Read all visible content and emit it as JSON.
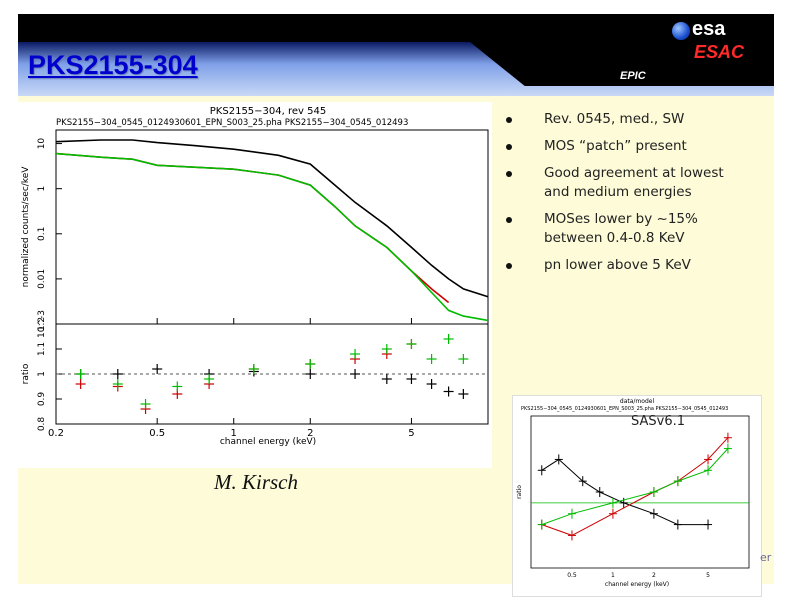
{
  "header": {
    "title": "PKS2155-304",
    "logo_text": "esa",
    "org": "ESAC",
    "section": "EPIC"
  },
  "bullets": [
    "Rev. 0545, med., SW",
    "MOS “patch” present",
    "Good agreement at lowest and medium energies",
    "MOSes lower by ~15% between 0.4-0.8 KeV",
    "pn lower above 5 KeV"
  ],
  "author": "M. Kirsch",
  "inset_label": "SASv6.1",
  "footer_cut_text": "er",
  "chart_data": [
    {
      "type": "line",
      "title": "PKS2155−304, rev 545",
      "subtitle": "PKS2155−304_0545_0124930601_EPN_S003_25.pha PKS2155−304_0545_012493",
      "xlabel": "channel energy (keV)",
      "ylabel": "normalized counts/sec/keV",
      "x_scale": "log",
      "y_scale": "log",
      "xlim": [
        0.2,
        10
      ],
      "ylim": [
        0.001,
        20
      ],
      "x_ticks": [
        "0.2",
        "0.5",
        "1",
        "2",
        "5"
      ],
      "y_ticks": [
        "10",
        "1",
        "0.1",
        "0.01",
        "10^-3"
      ],
      "series": [
        {
          "color": "#000000",
          "x": [
            0.2,
            0.3,
            0.4,
            0.5,
            0.7,
            1.0,
            1.5,
            2.0,
            2.5,
            3.0,
            4.0,
            5.0,
            6.0,
            7.0,
            8.0,
            10.0
          ],
          "y": [
            11,
            12,
            12,
            10.5,
            9,
            7.5,
            5.5,
            3.5,
            1.2,
            0.5,
            0.15,
            0.05,
            0.02,
            0.01,
            0.006,
            0.004
          ]
        },
        {
          "color": "#cc0000",
          "x": [
            0.2,
            0.3,
            0.4,
            0.5,
            0.7,
            1.0,
            1.5,
            2.0,
            2.5,
            3.0,
            4.0,
            5.0,
            6.0,
            7.0
          ],
          "y": [
            6,
            5,
            4.5,
            3.3,
            3.0,
            2.7,
            2.0,
            1.2,
            0.4,
            0.15,
            0.05,
            0.015,
            0.006,
            0.003
          ]
        },
        {
          "color": "#00bb00",
          "x": [
            0.2,
            0.3,
            0.4,
            0.5,
            0.7,
            1.0,
            1.5,
            2.0,
            2.5,
            3.0,
            4.0,
            5.0,
            6.0,
            7.0,
            8.0,
            10.0
          ],
          "y": [
            6,
            5,
            4.5,
            3.3,
            3.0,
            2.7,
            2.0,
            1.2,
            0.4,
            0.15,
            0.05,
            0.015,
            0.005,
            0.002,
            0.0015,
            0.0012
          ]
        }
      ]
    },
    {
      "type": "scatter",
      "ylabel": "ratio",
      "xlabel": "channel energy (keV)",
      "x_scale": "log",
      "xlim": [
        0.2,
        10
      ],
      "ylim": [
        0.8,
        1.2
      ],
      "y_ticks": [
        "0.8",
        "0.9",
        "1",
        "1.1",
        "1.2"
      ],
      "x_ticks": [
        "0.2",
        "0.5",
        "1",
        "2",
        "5"
      ],
      "series": [
        {
          "color": "#000000",
          "x": [
            0.25,
            0.35,
            0.5,
            0.8,
            1.2,
            2.0,
            3.0,
            4.0,
            5.0,
            6.0,
            7.0,
            8.0
          ],
          "y": [
            1.0,
            1.0,
            1.02,
            1.0,
            1.01,
            1.0,
            1.0,
            0.98,
            0.98,
            0.96,
            0.93,
            0.92
          ]
        },
        {
          "color": "#cc0000",
          "x": [
            0.25,
            0.35,
            0.45,
            0.6,
            0.8,
            1.2,
            2.0,
            3.0,
            4.0,
            5.0
          ],
          "y": [
            0.96,
            0.95,
            0.86,
            0.92,
            0.96,
            1.02,
            1.04,
            1.06,
            1.08,
            1.12
          ]
        },
        {
          "color": "#00bb00",
          "x": [
            0.25,
            0.35,
            0.45,
            0.6,
            0.8,
            1.2,
            2.0,
            3.0,
            4.0,
            5.0,
            6.0,
            7.0,
            8.0
          ],
          "y": [
            1.0,
            0.96,
            0.88,
            0.95,
            0.98,
            1.02,
            1.04,
            1.08,
            1.1,
            1.12,
            1.06,
            1.14,
            1.06
          ]
        }
      ]
    },
    {
      "type": "scatter",
      "title": "data/model",
      "subtitle": "PKS2155−304_0545_0124930601_EPN_S003_25.pha PKS2155−304_0545_012493",
      "xlabel": "channel energy (keV)",
      "ylabel": "ratio",
      "x_ticks": [
        "0.5",
        "1",
        "2",
        "5"
      ],
      "series": [
        {
          "color": "#000000",
          "x": [
            0.3,
            0.4,
            0.6,
            0.8,
            1.2,
            2.0,
            3.0,
            5.0
          ],
          "y": [
            1.15,
            1.2,
            1.1,
            1.05,
            1.0,
            0.95,
            0.9,
            0.9
          ]
        },
        {
          "color": "#cc0000",
          "x": [
            0.3,
            0.5,
            1.0,
            2.0,
            3.0,
            5.0,
            7.0
          ],
          "y": [
            0.9,
            0.85,
            0.95,
            1.05,
            1.1,
            1.2,
            1.3
          ]
        },
        {
          "color": "#00bb00",
          "x": [
            0.3,
            0.5,
            1.0,
            2.0,
            3.0,
            5.0,
            7.0
          ],
          "y": [
            0.9,
            0.95,
            1.0,
            1.05,
            1.1,
            1.15,
            1.25
          ]
        }
      ]
    }
  ]
}
